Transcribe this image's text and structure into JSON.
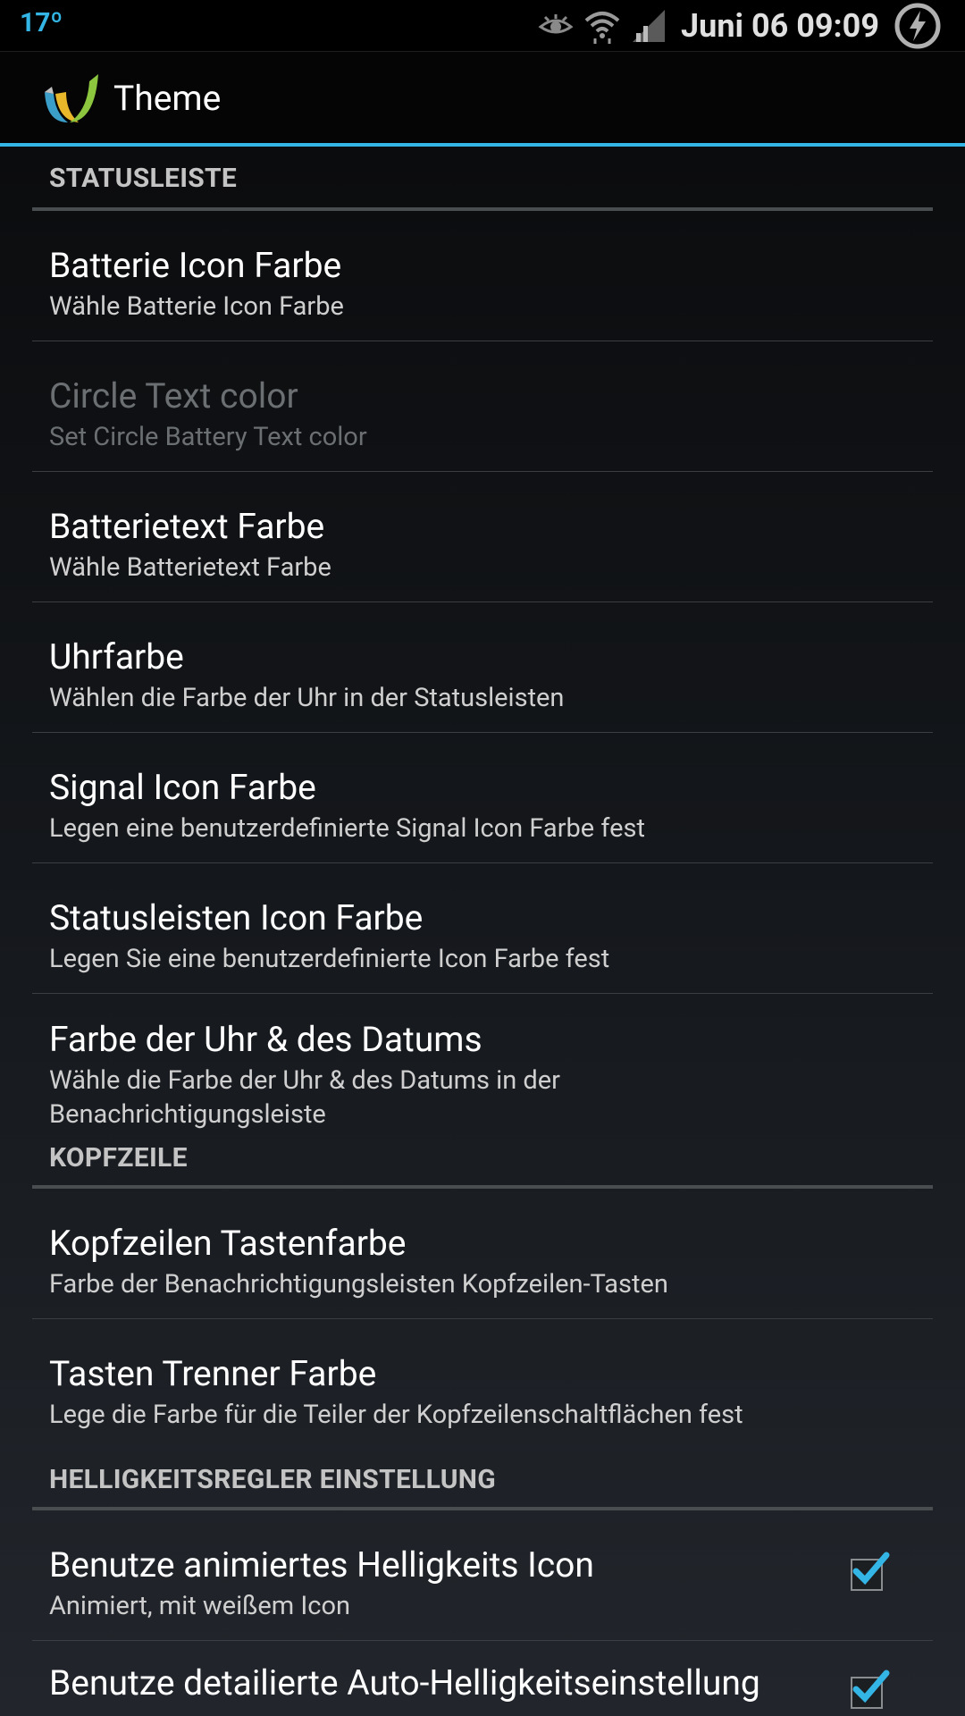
{
  "status_bar": {
    "temperature": "17º",
    "time": "Juni 06 09:09",
    "icons": [
      "eye-icon",
      "wifi-icon",
      "signal-icon",
      "battery-charging-icon"
    ]
  },
  "action_bar": {
    "title": "Theme",
    "accent_color": "#33b5e5"
  },
  "sections": [
    {
      "header": "STATUSLEISTE",
      "items": [
        {
          "title": "Batterie Icon Farbe",
          "summary": "Wähle Batterie Icon Farbe",
          "enabled": true
        },
        {
          "title": "Circle Text color",
          "summary": "Set Circle Battery Text color",
          "enabled": false
        },
        {
          "title": "Batterietext Farbe",
          "summary": "Wähle Batterietext Farbe",
          "enabled": true
        },
        {
          "title": "Uhrfarbe",
          "summary": "Wählen die Farbe der Uhr in der Statusleisten",
          "enabled": true
        },
        {
          "title": "Signal Icon Farbe",
          "summary": "Legen eine benutzerdefinierte Signal Icon Farbe fest",
          "enabled": true
        },
        {
          "title": "Statusleisten Icon Farbe",
          "summary": "Legen Sie eine benutzerdefinierte Icon Farbe fest",
          "enabled": true
        },
        {
          "title": "Farbe der Uhr & des Datums",
          "summary": "Wähle die Farbe der Uhr & des Datums in der Benachrichtigungsleiste",
          "enabled": true
        }
      ]
    },
    {
      "header": "KOPFZEILE",
      "items": [
        {
          "title": "Kopfzeilen Tastenfarbe",
          "summary": "Farbe der Benachrichtigungsleisten Kopfzeilen-Tasten",
          "enabled": true
        },
        {
          "title": "Tasten Trenner Farbe",
          "summary": "Lege die Farbe für die Teiler der Kopfzeilenschaltflächen fest",
          "enabled": true
        }
      ]
    },
    {
      "header": "HELLIGKEITSREGLER EINSTELLUNG",
      "items": [
        {
          "title": "Benutze animiertes Helligkeits Icon",
          "summary": "Animiert, mit weißem Icon",
          "enabled": true,
          "checked": true
        },
        {
          "title": "Benutze detailierte Auto-Helligkeitseinstellung",
          "summary": "",
          "enabled": true,
          "checked": true
        }
      ]
    }
  ]
}
